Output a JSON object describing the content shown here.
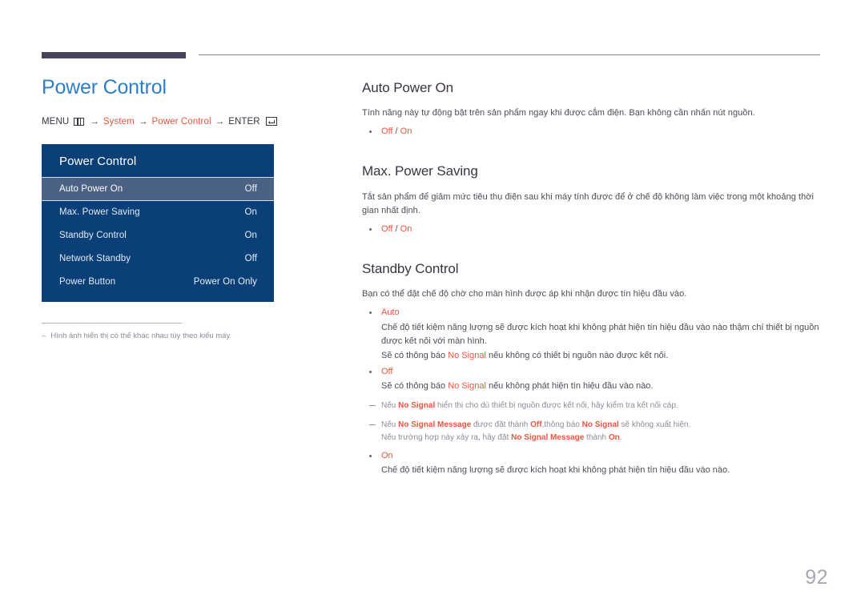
{
  "document": {
    "page_number": "92"
  },
  "left": {
    "title": "Power Control",
    "breadcrumb": {
      "menu_label": "MENU",
      "menu_icon": "menu-bars-icon",
      "arrow1": "→",
      "item1": "System",
      "arrow2": "→",
      "item2": "Power Control",
      "arrow3": "→",
      "enter_label": "ENTER",
      "enter_icon": "enter-key-icon"
    },
    "osd": {
      "title": "Power Control",
      "rows": [
        {
          "label": "Auto Power On",
          "value": "Off",
          "selected": true
        },
        {
          "label": "Max. Power Saving",
          "value": "On",
          "selected": false
        },
        {
          "label": "Standby Control",
          "value": "On",
          "selected": false
        },
        {
          "label": "Network Standby",
          "value": "Off",
          "selected": false
        },
        {
          "label": "Power Button",
          "value": "Power On Only",
          "selected": false
        }
      ]
    },
    "footnote": {
      "dash": "–",
      "text": "Hình ảnh hiển thị có thể khác nhau tùy theo kiểu máy."
    }
  },
  "right": {
    "sections": [
      {
        "heading": "Auto Power On",
        "paragraph": "Tính năng này tự động bật trên sản phẩm ngay khi được cắm điện. Bạn không cần nhấn nút nguồn.",
        "option_off": "Off",
        "option_sep": "/",
        "option_on": "On"
      },
      {
        "heading": "Max. Power Saving",
        "paragraph": "Tắt sản phẩm để giảm mức tiêu thụ điện sau khi máy tính được để ở chế độ không làm việc trong một khoảng thời gian nhất định.",
        "option_off": "Off",
        "option_sep": "/",
        "option_on": "On"
      }
    ],
    "standby": {
      "heading": "Standby Control",
      "paragraph": "Bạn có thể đặt chế độ chờ cho màn hình được áp khi nhận được tín hiệu đầu vào.",
      "auto": {
        "label": "Auto",
        "line1": "Chế độ tiết kiệm năng lượng sẽ được kích hoạt khi không phát hiện tín hiệu đầu vào nào thậm chí thiết bị nguồn được kết nối với màn hình.",
        "line2_pre": "Sẽ có thông báo ",
        "line2_accent": "No Signal",
        "line2_post": " nếu không có thiết bị nguồn nào được kết nối."
      },
      "off": {
        "label": "Off",
        "line1_pre": "Sẽ có thông báo ",
        "line1_accent": "No Signal",
        "line1_post": " nếu không phát hiện tín hiệu đầu vào nào.",
        "note1_pre": "Nếu ",
        "note1_accent": "No Signal",
        "note1_post": " hiển thị cho dù thiết bị nguồn được kết nối, hãy kiểm tra kết nối cáp.",
        "note2_pre": "Nếu ",
        "note2_a1": "No Signal Message",
        "note2_mid1": " được đặt thành ",
        "note2_a2": "Off",
        "note2_mid2": ",thông báo ",
        "note2_a3": "No Signal",
        "note2_post": " sẽ không xuất hiện.",
        "note2_cont_pre": "Nếu trường hợp này xảy ra, hãy đặt ",
        "note2_cont_a1": "No Signal Message",
        "note2_cont_mid": " thành ",
        "note2_cont_a2": "On",
        "note2_cont_post": "."
      },
      "on": {
        "label": "On",
        "line1": "Chế độ tiết kiệm năng lượng sẽ được kích hoạt khi không phát hiện tín hiệu đầu vào nào."
      }
    }
  },
  "colors": {
    "title_blue": "#2f7fc6",
    "accent_orange": "#e8573f",
    "osd_blue": "#0a4077",
    "osd_selected": "#4b6284",
    "heading_dark": "#3b3341",
    "rule_dark": "#47435a",
    "muted": "#8d8a96"
  }
}
